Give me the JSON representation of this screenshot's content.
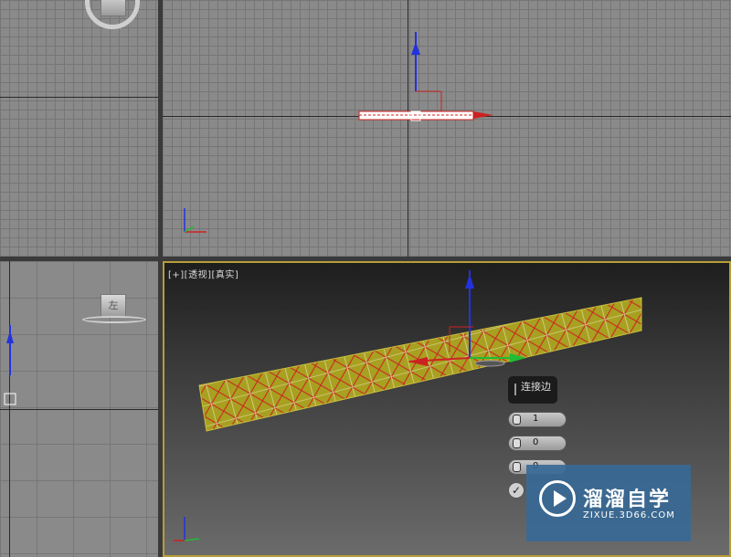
{
  "perspective_viewport": {
    "label": "[+][透视][真实]"
  },
  "left_viewport": {
    "navcube_label": "左"
  },
  "caddy": {
    "title": "连接边",
    "segments": "1",
    "pinch": "0",
    "slide": "0"
  },
  "watermark": {
    "name": "溜溜自学",
    "url": "ZIXUE.3D66.COM"
  },
  "colors": {
    "active_border": "#b79d3a",
    "selection": "#a8a020",
    "x_axis": "#cc2222",
    "y_axis": "#22bb33",
    "z_axis": "#2233dd"
  }
}
